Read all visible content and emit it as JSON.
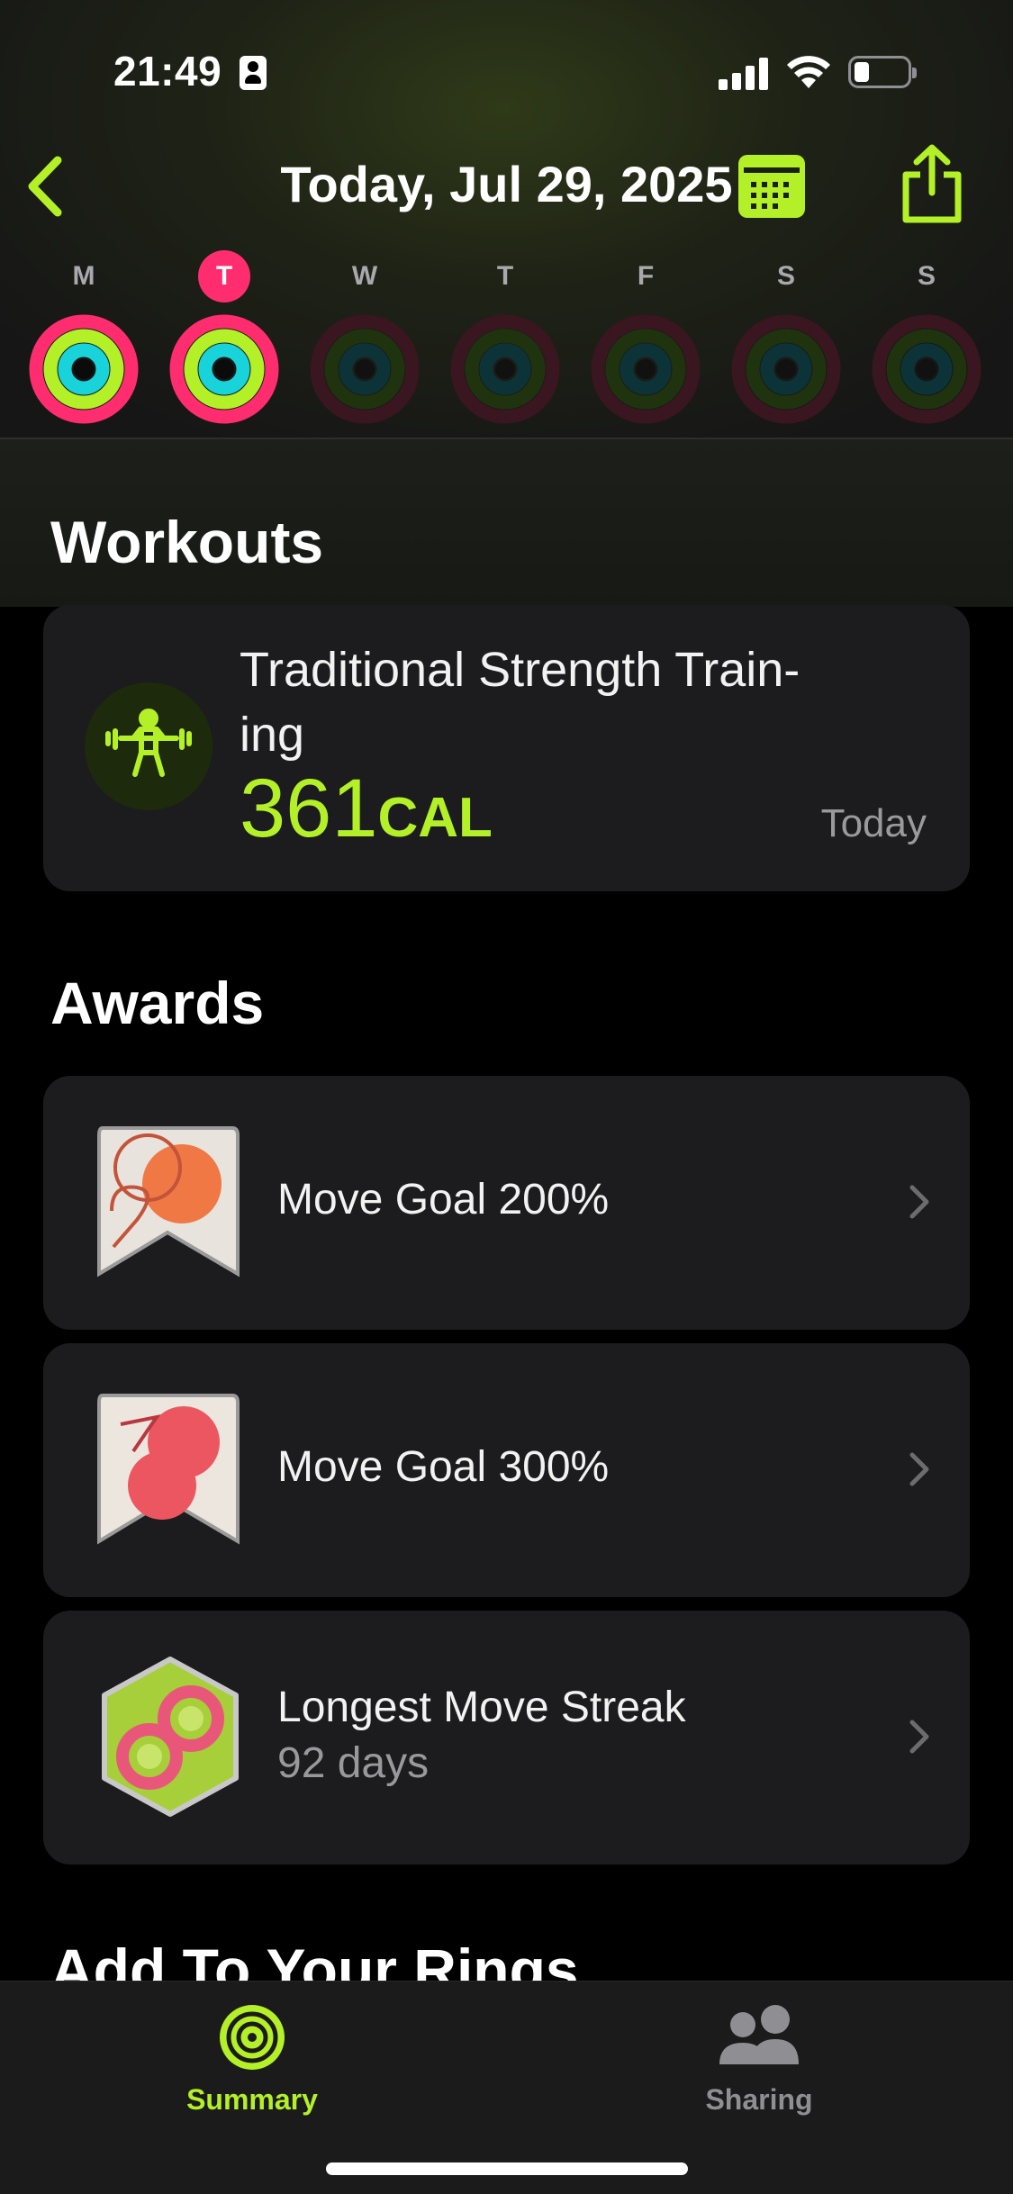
{
  "status_bar": {
    "time": "21:49",
    "battery_level": 0.2
  },
  "nav": {
    "title": "Today, Jul 29, 2025",
    "back_icon": "chevron-left-icon",
    "calendar_icon": "calendar-icon",
    "share_icon": "share-icon"
  },
  "week": {
    "days": [
      {
        "letter": "M",
        "active": true,
        "is_today": false
      },
      {
        "letter": "T",
        "active": true,
        "is_today": true
      },
      {
        "letter": "W",
        "active": false,
        "is_today": false
      },
      {
        "letter": "T",
        "active": false,
        "is_today": false
      },
      {
        "letter": "F",
        "active": false,
        "is_today": false
      },
      {
        "letter": "S",
        "active": false,
        "is_today": false
      },
      {
        "letter": "S",
        "active": false,
        "is_today": false
      }
    ]
  },
  "workouts": {
    "title": "Workouts",
    "items": [
      {
        "name": "Traditional Strength Train-ing",
        "name_line1": "Traditional Strength Train-",
        "name_line2": "ing",
        "calories": "361",
        "unit": "CAL",
        "date": "Today",
        "icon": "strength-training-icon"
      }
    ]
  },
  "awards": {
    "title": "Awards",
    "items": [
      {
        "title": "Move Goal 200%",
        "subtitle": "",
        "icon": "move-goal-200-badge-icon"
      },
      {
        "title": "Move Goal 300%",
        "subtitle": "",
        "icon": "move-goal-300-badge-icon"
      },
      {
        "title": "Longest Move Streak",
        "subtitle": "92 days",
        "icon": "longest-move-streak-badge-icon"
      }
    ]
  },
  "next_section": {
    "title": "Add To Your Rings"
  },
  "tab_bar": {
    "tabs": [
      {
        "label": "Summary",
        "selected": true,
        "icon": "activity-rings-icon"
      },
      {
        "label": "Sharing",
        "selected": false,
        "icon": "people-icon"
      }
    ]
  },
  "colors": {
    "accent": "#b3f027",
    "move": "#ff2d6f",
    "exercise": "#b3f027",
    "stand": "#19d3da",
    "card": "#1c1c1e",
    "secondary_text": "#98989d"
  }
}
